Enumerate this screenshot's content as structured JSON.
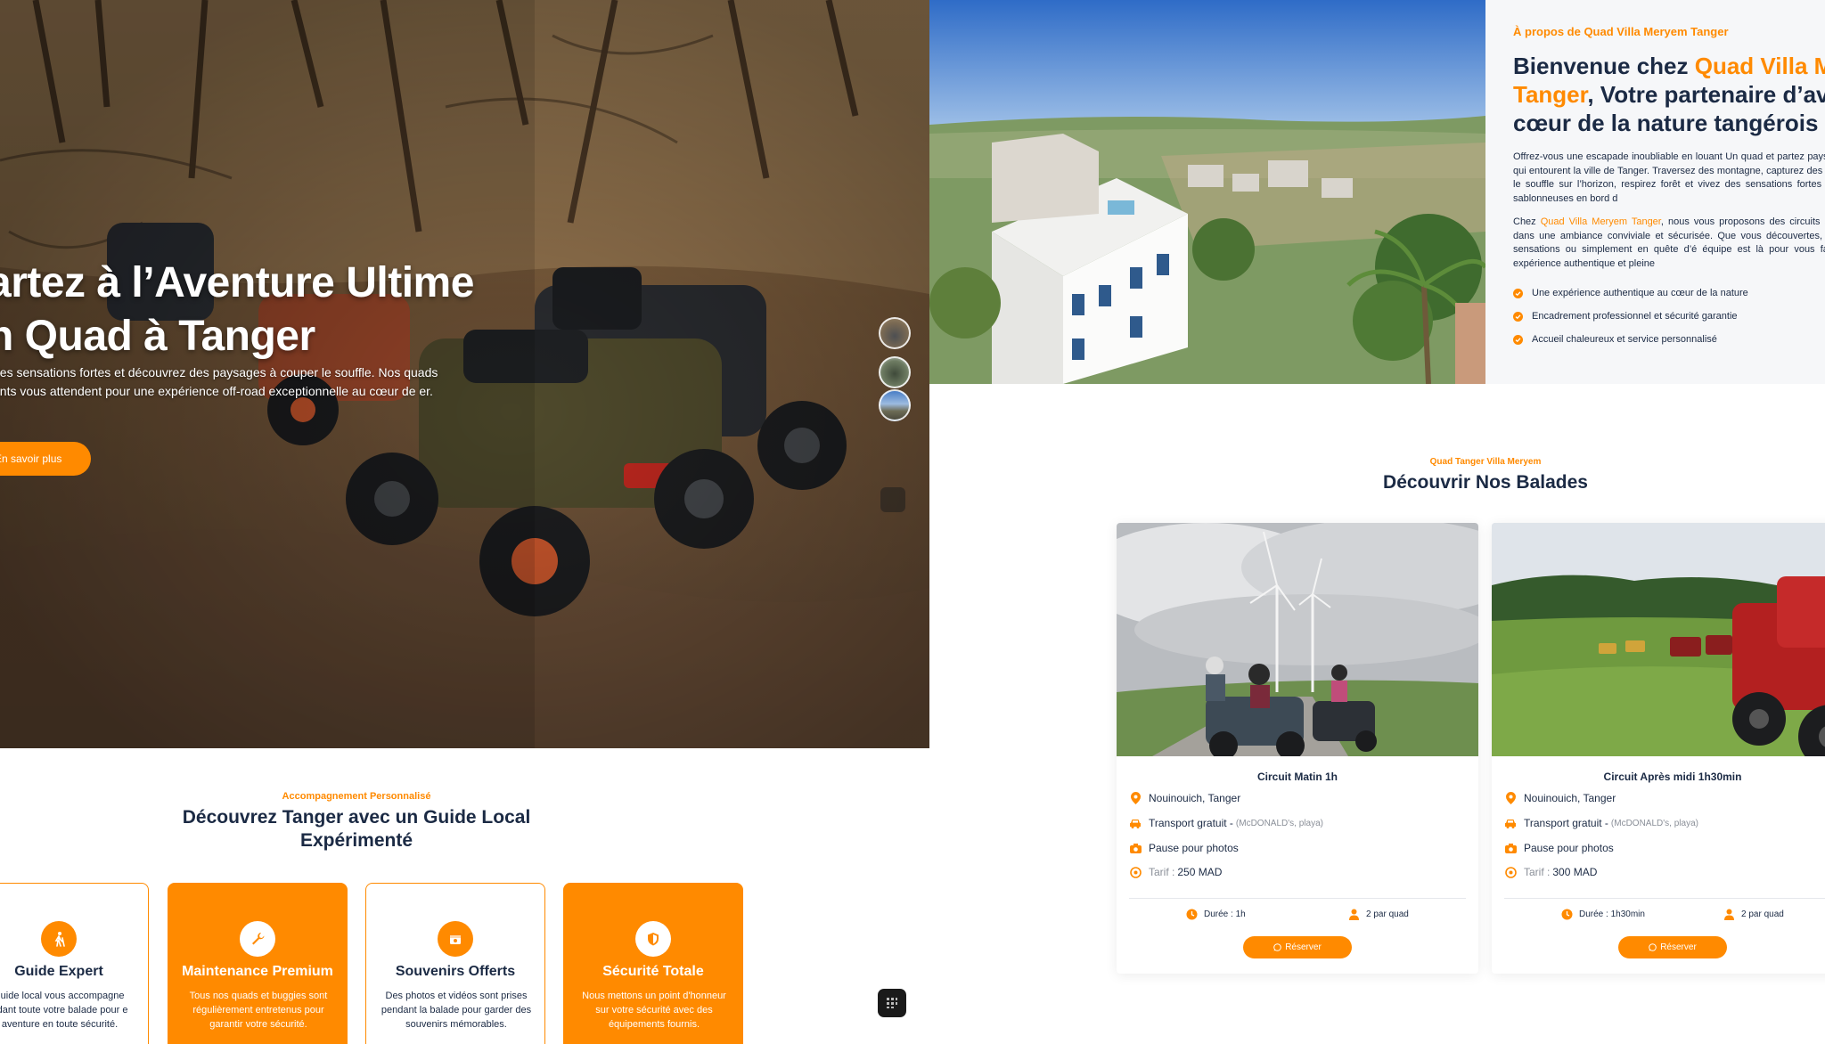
{
  "colors": {
    "accent": "#ff8a00",
    "heading": "#1b2a44",
    "muted": "#8a8f98"
  },
  "hero": {
    "title_line1": "artez à l’Aventure Ultime",
    "title_line2": "n Quad à Tanger",
    "subtitle": "des sensations fortes et découvrez des paysages à couper le souffle. Nos quads ants vous attendent pour une expérience off-road exceptionnelle au cœur de er.",
    "cta": "En savoir plus",
    "thumbnails": [
      "thumbnail-1",
      "thumbnail-2",
      "thumbnail-3"
    ]
  },
  "guide": {
    "eyebrow": "Accompagnement Personnalisé",
    "title": "Découvrez Tanger avec un Guide Local Expérimenté",
    "features": [
      {
        "icon": "hiker-icon",
        "title": "Guide Expert",
        "desc": "guide local vous accompagne ndant toute votre balade pour e aventure en toute sécurité."
      },
      {
        "icon": "wrench-icon",
        "title": "Maintenance Premium",
        "desc": "Tous nos quads et buggies sont régulièrement entretenus pour garantir votre sécurité."
      },
      {
        "icon": "gift-icon",
        "title": "Souvenirs Offerts",
        "desc": "Des photos et vidéos sont prises pendant la balade pour garder des souvenirs mémorables."
      },
      {
        "icon": "shield-icon",
        "title": "Sécurité Totale",
        "desc": "Nous mettons un point d'honneur sur votre sécurité avec des équipements fournis."
      }
    ]
  },
  "about": {
    "eyebrow": "À propos de Quad Villa Meryem Tanger",
    "title_pre": "Bienvenue chez ",
    "title_hl": "Quad Villa Me Tanger",
    "title_post": ", Votre partenaire d’ave au cœur de la nature tangérois",
    "p1": "Offrez-vous une escapade inoubliable en louant Un quad et partez paysages naturels qui entourent la ville de Tanger. Traversez des montagne, capturez des vues à couper le souffle sur l’horizon, respirez forêt et vivez des sensations fortes sur les pistes sablonneuses en bord d",
    "p2_pre": "Chez ",
    "p2_hl": "Quad Villa Meryem Tanger",
    "p2_post": ", nous vous proposons des circuits adap niveaux, dans une ambiance conviviale et sécurisée. Que vous découvertes, passionné de sensations ou simplement en quête d’é équipe est là pour vous faire vivre une expérience authentique et pleine",
    "checks": [
      "Une expérience authentique au cœur de la nature",
      "Encadrement professionnel et sécurité garantie",
      "Accueil chaleureux et service personnalisé"
    ]
  },
  "balades": {
    "eyebrow": "Quad Tanger Villa Meryem",
    "title": "Découvrir Nos Balades",
    "cards": [
      {
        "title": "Circuit Matin 1h",
        "location": "Nouinouich, Tanger",
        "transport": "Transport gratuit -",
        "transport_note": "(McDONALD's, playa)",
        "photos": "Pause pour photos",
        "tarif_label": "Tarif :",
        "tarif": "250 MAD",
        "duration": "Durée : 1h",
        "people": "2 par quad",
        "reserve": "Réserver"
      },
      {
        "title": "Circuit Après midi 1h30min",
        "location": "Nouinouich, Tanger",
        "transport": "Transport gratuit -",
        "transport_note": "(McDONALD's, playa)",
        "photos": "Pause pour photos",
        "tarif_label": "Tarif :",
        "tarif": "300 MAD",
        "duration": "Durée : 1h30min",
        "people": "2 par quad",
        "reserve": "Réserver"
      }
    ]
  }
}
